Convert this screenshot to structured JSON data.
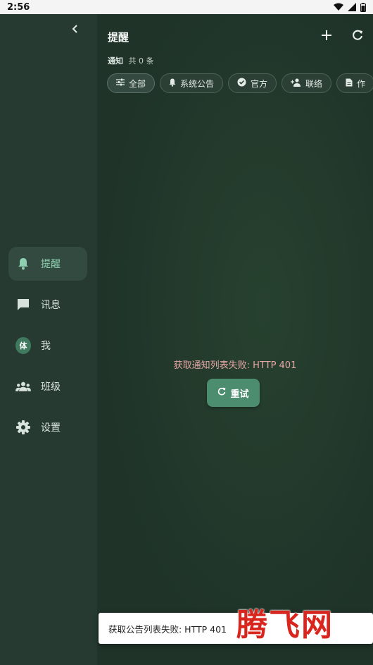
{
  "status_bar": {
    "time": "2:56"
  },
  "sidebar": {
    "items": [
      {
        "label": "提醒",
        "icon": "bell-icon"
      },
      {
        "label": "讯息",
        "icon": "chat-icon"
      },
      {
        "label": "我",
        "icon": "avatar",
        "avatar_text": "体"
      },
      {
        "label": "班级",
        "icon": "group-icon"
      },
      {
        "label": "设置",
        "icon": "gear-icon"
      }
    ]
  },
  "header": {
    "title": "提醒"
  },
  "subheader": {
    "label": "通知",
    "count": "共 0 条"
  },
  "filters": [
    {
      "label": "全部",
      "icon": "tune-icon",
      "selected": true
    },
    {
      "label": "系统公告",
      "icon": "bell-icon"
    },
    {
      "label": "官方",
      "icon": "verified-icon"
    },
    {
      "label": "联络",
      "icon": "person-add-icon"
    },
    {
      "label": "作",
      "icon": "document-icon"
    }
  ],
  "error": {
    "message": "获取通知列表失败: HTTP 401",
    "retry_label": "重试"
  },
  "toast": {
    "message": "获取公告列表失败: HTTP 401"
  },
  "watermark": "腾飞网",
  "colors": {
    "accent": "#4c8c6f",
    "error": "#e7a6a6",
    "active_nav": "#8ed0b0"
  }
}
